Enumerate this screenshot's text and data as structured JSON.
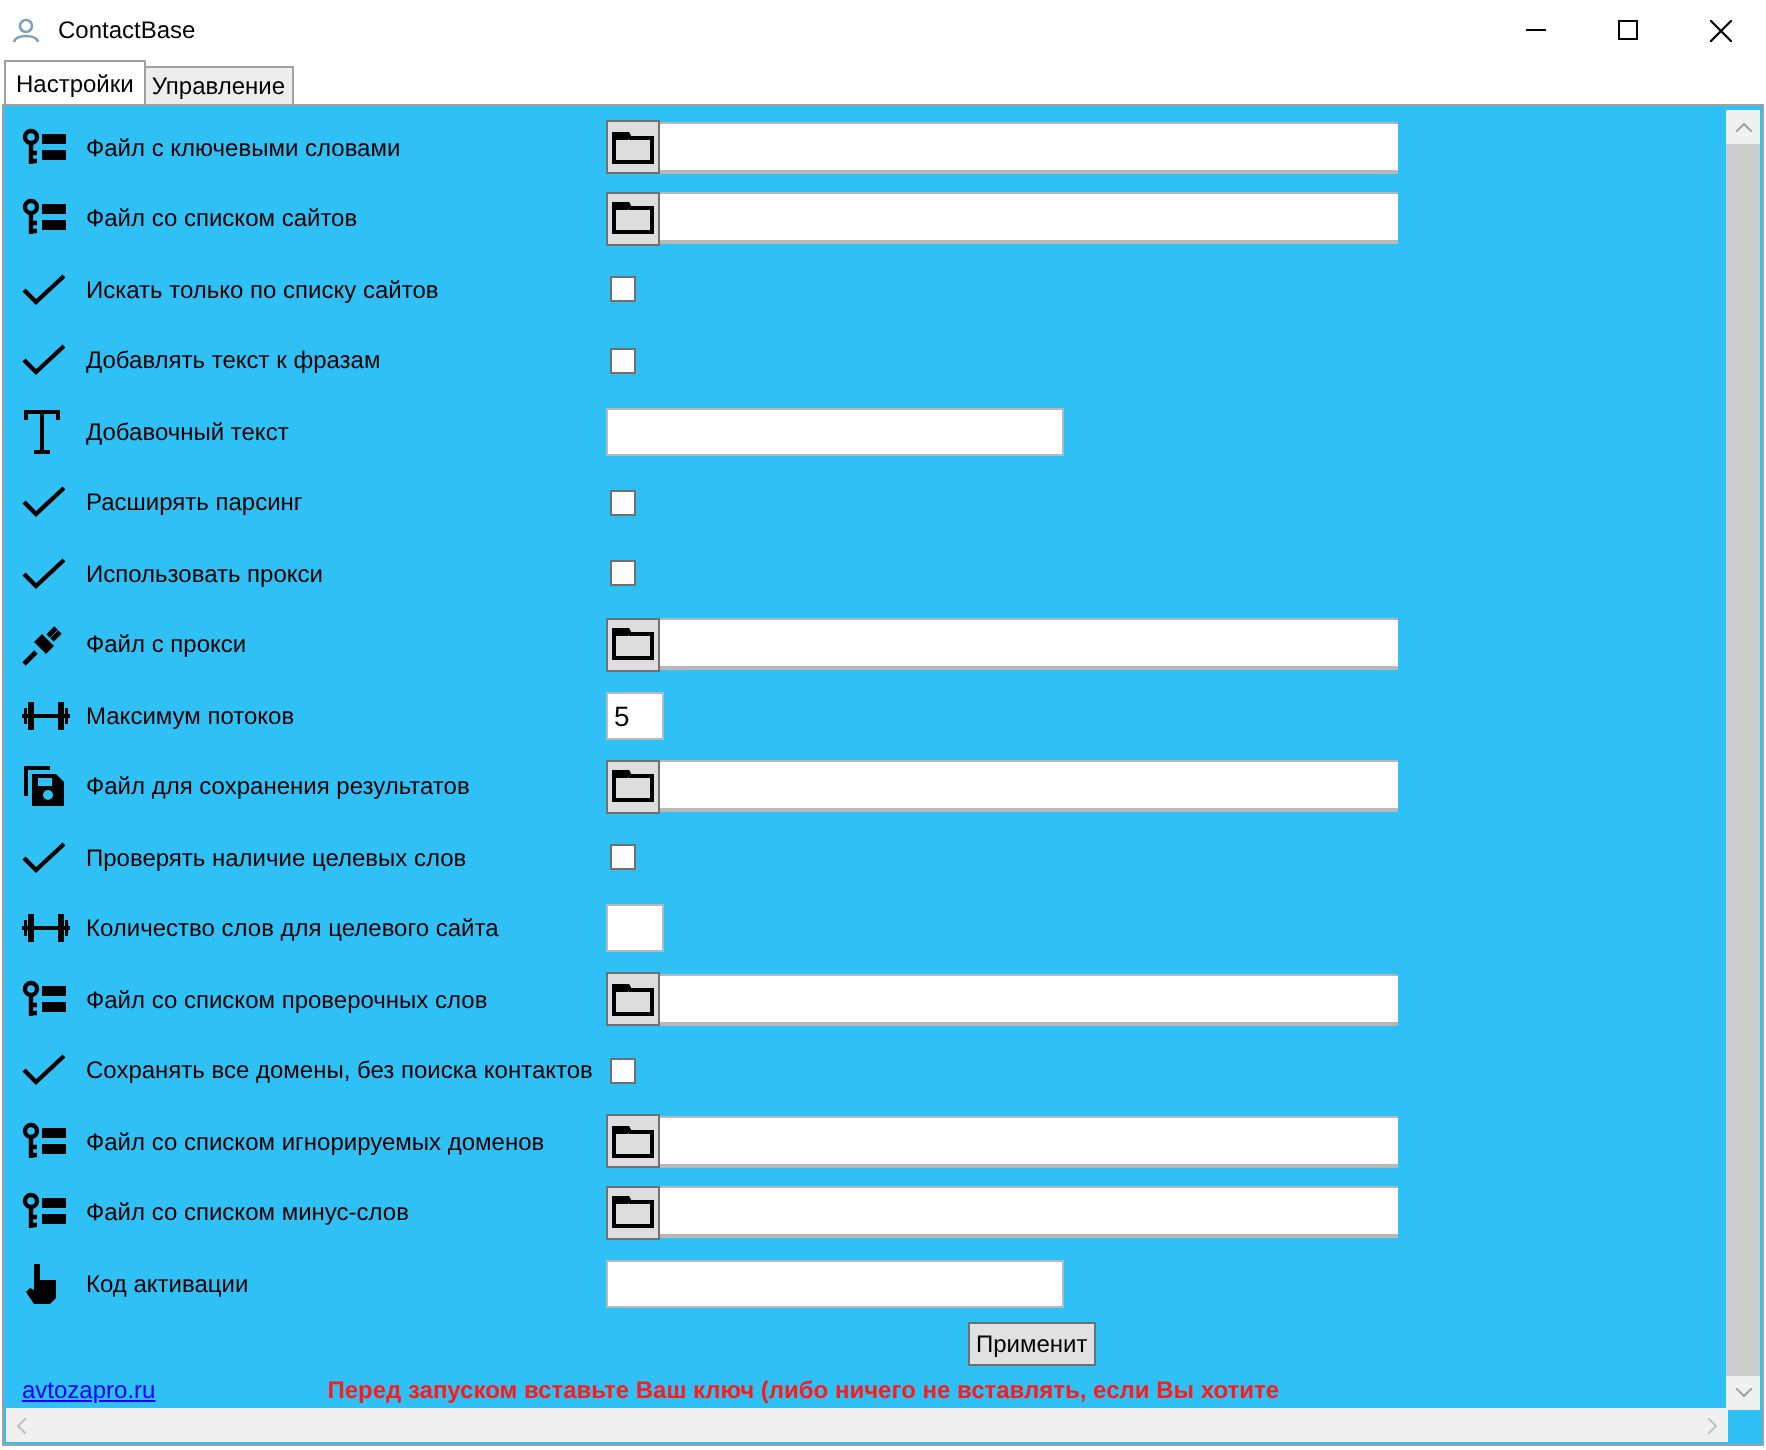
{
  "window": {
    "title": "ContactBase"
  },
  "tabs": [
    {
      "label": "Настройки",
      "selected": true
    },
    {
      "label": "Управление",
      "selected": false
    }
  ],
  "rows": [
    {
      "label": "Файл с ключевыми словами",
      "kind": "file"
    },
    {
      "label": "Файл со списком сайтов",
      "kind": "file"
    },
    {
      "label": "Искать только по списку сайтов",
      "kind": "checkbox",
      "checked": false
    },
    {
      "label": "Добавлять текст к фразам",
      "kind": "checkbox",
      "checked": false
    },
    {
      "label": "Добавочный текст",
      "kind": "text"
    },
    {
      "label": "Расширять парсинг",
      "kind": "checkbox",
      "checked": false
    },
    {
      "label": "Использовать прокси",
      "kind": "checkbox",
      "checked": false
    },
    {
      "label": "Файл с прокси",
      "kind": "file"
    },
    {
      "label": "Максимум потоков",
      "kind": "number",
      "value": "5"
    },
    {
      "label": "Файл для сохранения результатов",
      "kind": "file"
    },
    {
      "label": "Проверять наличие целевых слов",
      "kind": "checkbox",
      "checked": false
    },
    {
      "label": "Количество слов для целевого сайта",
      "kind": "number"
    },
    {
      "label": "Файл со списком проверочных слов",
      "kind": "file"
    },
    {
      "label": "Сохранять все домены, без поиска контактов",
      "kind": "checkbox",
      "checked": false
    },
    {
      "label": "Файл со списком игнорируемых доменов",
      "kind": "file"
    },
    {
      "label": "Файл со списком минус-слов",
      "kind": "file"
    },
    {
      "label": "Код активации",
      "kind": "text"
    }
  ],
  "apply_button": "Применит",
  "link": "avtozapro.ru",
  "notice": "Перед запуском вставьте Ваш ключ (либо ничего не вставлять, если Вы хотите"
}
